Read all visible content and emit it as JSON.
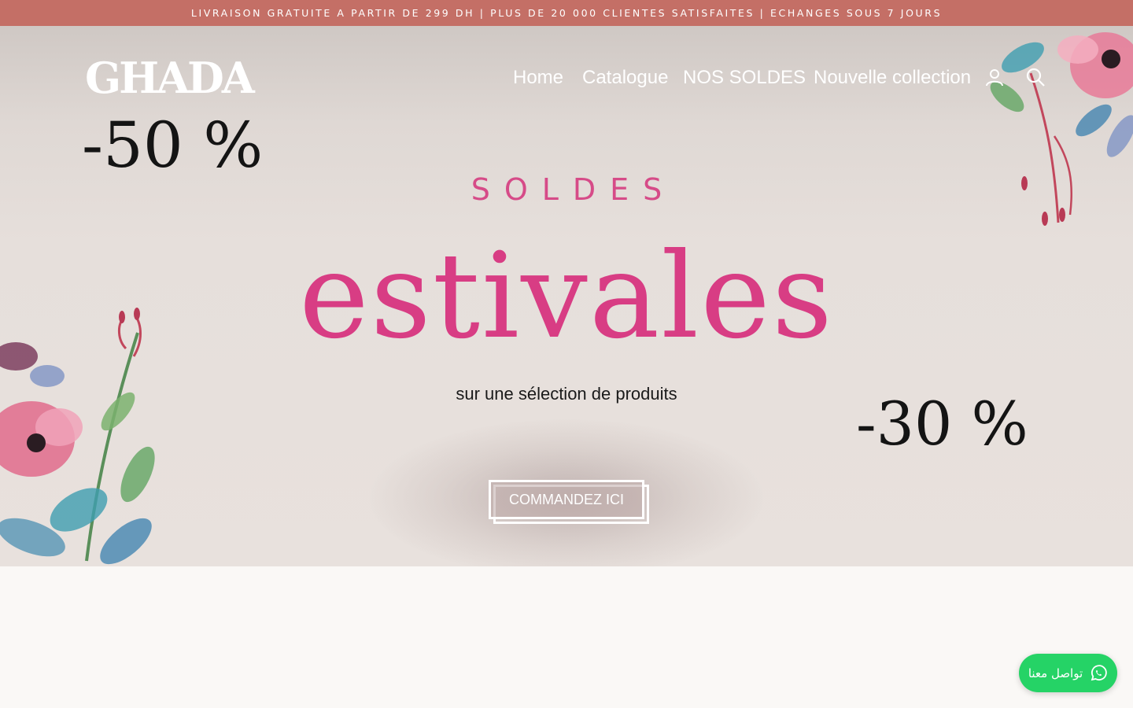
{
  "announcement": {
    "text": "LIVRAISON GRATUITE A PARTIR DE 299 DH | PLUS DE 20 000 CLIENTES SATISFAITES | ECHANGES SOUS 7 JOURS"
  },
  "header": {
    "logo": "GHADA",
    "nav": [
      {
        "label": "Home"
      },
      {
        "label": "Catalogue"
      },
      {
        "label": "NOS SOLDES"
      },
      {
        "label": "Nouvelle collection"
      }
    ],
    "icons": [
      "account-icon",
      "search-icon"
    ]
  },
  "hero": {
    "promo_left": "-50 %",
    "promo_right": "-30 %",
    "kicker": "SOLDES",
    "headline": "estivales",
    "subtitle": "sur une sélection de produits",
    "cta_label": "COMMANDEZ ICI",
    "colors": {
      "accent": "#d83d84",
      "announce_bg": "#c46f66"
    }
  },
  "whatsapp": {
    "label": "تواصل معنا",
    "color": "#25d366"
  }
}
